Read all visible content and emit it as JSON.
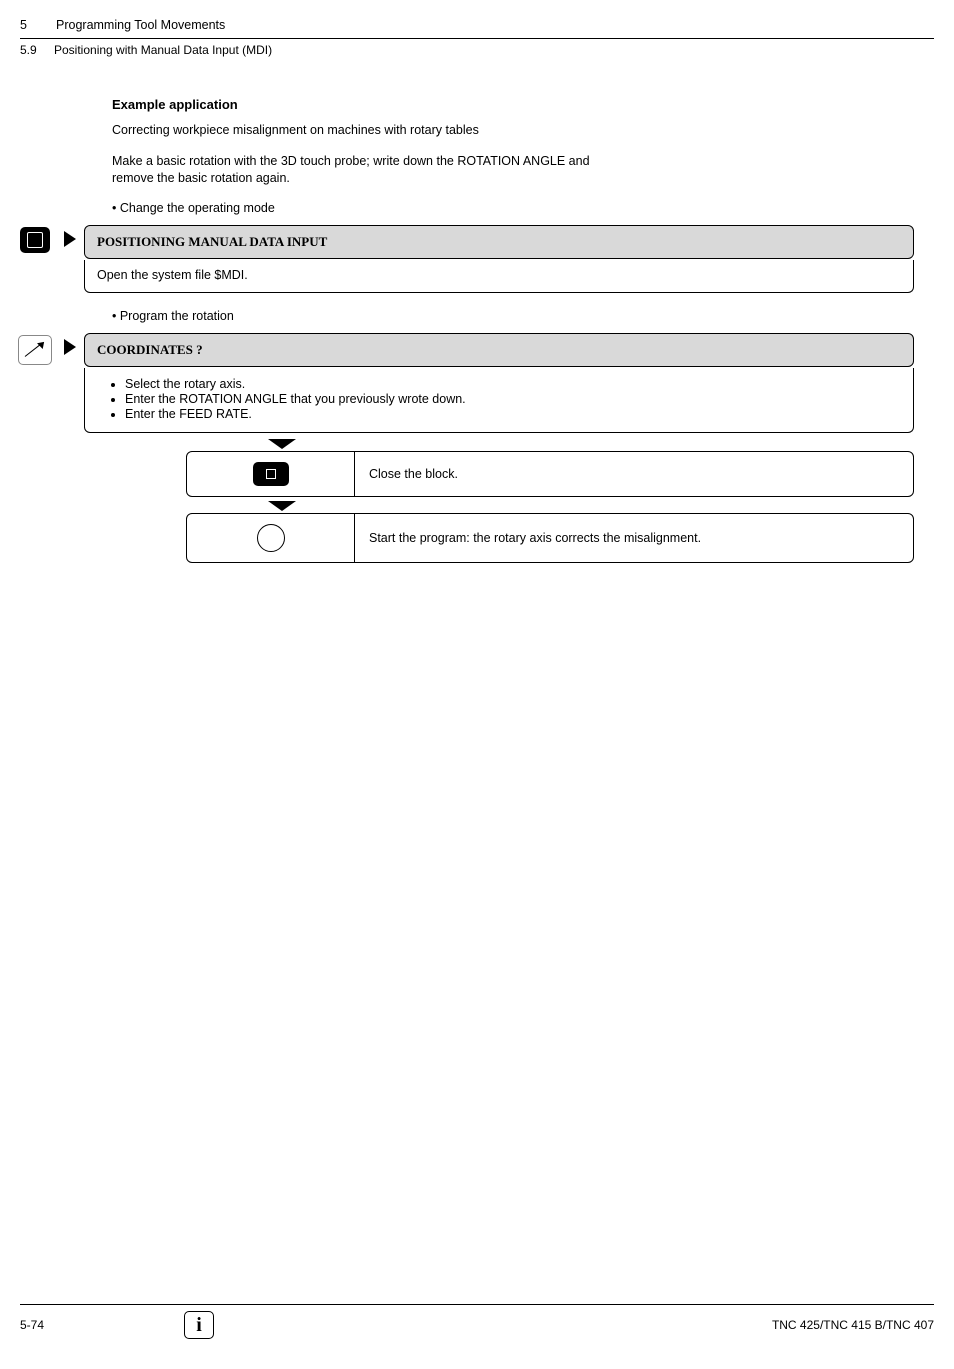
{
  "header": {
    "chapter_num": "5",
    "chapter_title": "Programming Tool Movements",
    "section_num": "5.9",
    "section_title": "Positioning with Manual Data Input (MDI)"
  },
  "content": {
    "heading": "Example application",
    "intro_1": "Correcting workpiece misalignment on machines with rotary tables",
    "intro_2": "Make a basic rotation with the 3D touch probe; write down the ROTATION ANGLE and remove the basic rotation again.",
    "step1_bullet": "• Change the operating mode",
    "step1_box_title": "POSITIONING MANUAL DATA INPUT",
    "step1_box_body": "Open the system file $MDI.",
    "step2_bullet": "• Program the rotation",
    "step2_box_title": "COORDINATES ?",
    "step2_items": [
      "Select the rotary axis.",
      "Enter the ROTATION ANGLE that you previously wrote down.",
      "Enter the FEED RATE."
    ],
    "subrow1_text": "Close the block.",
    "subrow2_text": "Start the program: the rotary axis corrects the misalignment."
  },
  "footer": {
    "page": "5-74",
    "model": "TNC 425/TNC 415 B/TNC 407",
    "info_glyph": "i"
  }
}
